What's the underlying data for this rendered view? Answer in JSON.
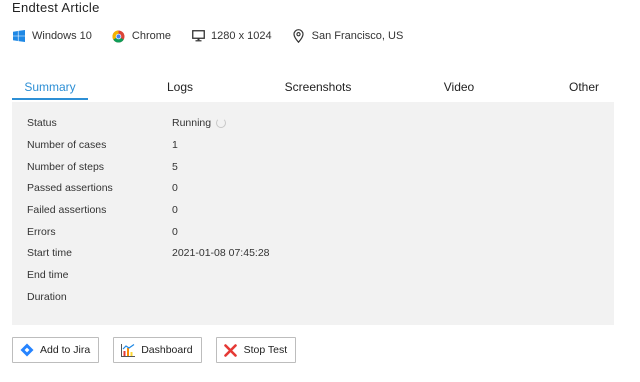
{
  "header": {
    "title": "Endtest Article"
  },
  "environment": {
    "os": {
      "icon": "windows-icon",
      "label": "Windows 10"
    },
    "browser": {
      "icon": "chrome-icon",
      "label": "Chrome"
    },
    "resolution": {
      "icon": "monitor-icon",
      "label": "1280 x 1024"
    },
    "location": {
      "icon": "location-pin-icon",
      "label": "San Francisco, US"
    }
  },
  "tabs": [
    {
      "label": "Summary",
      "active": true
    },
    {
      "label": "Logs",
      "active": false
    },
    {
      "label": "Screenshots",
      "active": false
    },
    {
      "label": "Video",
      "active": false
    },
    {
      "label": "Other",
      "active": false
    }
  ],
  "summary": {
    "rows": [
      {
        "key": "Status",
        "value": "Running"
      },
      {
        "key": "Number of cases",
        "value": "1"
      },
      {
        "key": "Number of steps",
        "value": "5"
      },
      {
        "key": "Passed assertions",
        "value": "0"
      },
      {
        "key": "Failed assertions",
        "value": "0"
      },
      {
        "key": "Errors",
        "value": "0"
      },
      {
        "key": "Start time",
        "value": "2021-01-08 07:45:28"
      },
      {
        "key": "End time",
        "value": ""
      },
      {
        "key": "Duration",
        "value": ""
      }
    ]
  },
  "actions": {
    "jira": {
      "label": "Add to Jira",
      "icon": "jira-icon"
    },
    "dashboard": {
      "label": "Dashboard",
      "icon": "dashboard-chart-icon"
    },
    "stop": {
      "label": "Stop Test",
      "icon": "stop-x-icon"
    }
  },
  "colors": {
    "accent": "#2d8fd5",
    "panel": "#f2f2f2",
    "stop": "#e53935",
    "jira": "#2684ff"
  }
}
